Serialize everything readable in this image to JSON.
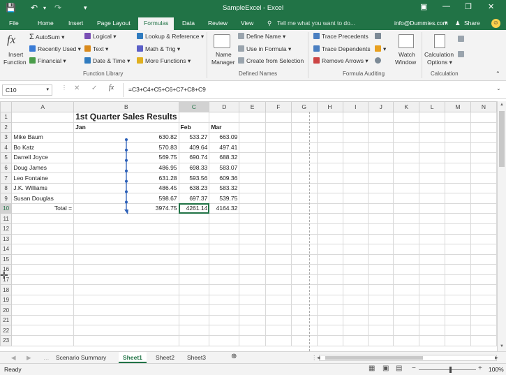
{
  "window": {
    "title": "SampleExcel - Excel",
    "account": "info@Dummies.com",
    "share": "Share",
    "tell_me": "Tell me what you want to do..."
  },
  "tabs": [
    "File",
    "Home",
    "Insert",
    "Page Layout",
    "Formulas",
    "Data",
    "Review",
    "View"
  ],
  "ribbon": {
    "insert_function": [
      "Insert",
      "Function"
    ],
    "library": {
      "autosum": "AutoSum",
      "recent": "Recently Used",
      "financial": "Financial",
      "logical": "Logical",
      "text": "Text",
      "datetime": "Date & Time",
      "lookup": "Lookup & Reference",
      "math": "Math & Trig",
      "more": "More Functions",
      "group": "Function Library"
    },
    "names": {
      "name_manager": [
        "Name",
        "Manager"
      ],
      "define": "Define Name",
      "use": "Use in Formula",
      "create": "Create from Selection",
      "group": "Defined Names"
    },
    "audit": {
      "precedents": "Trace Precedents",
      "dependents": "Trace Dependents",
      "remove": "Remove Arrows",
      "watch": [
        "Watch",
        "Window"
      ],
      "group": "Formula Auditing"
    },
    "calc": {
      "options": [
        "Calculation",
        "Options"
      ],
      "group": "Calculation"
    }
  },
  "formula_bar": {
    "name_box": "C10",
    "formula": "=C3+C4+C5+C6+C7+C8+C9"
  },
  "columns": [
    "A",
    "B",
    "C",
    "D",
    "E",
    "F",
    "G",
    "H",
    "I",
    "J",
    "K",
    "L",
    "M",
    "N"
  ],
  "sheet": {
    "title": "1st Quarter Sales Results",
    "months": [
      "Jan",
      "Feb",
      "Mar"
    ],
    "rows": [
      {
        "name": "Mike Baum",
        "jan": "630.82",
        "feb": "533.27",
        "mar": "663.09"
      },
      {
        "name": "Bo Katz",
        "jan": "570.83",
        "feb": "409.64",
        "mar": "497.41"
      },
      {
        "name": "Darrell Joyce",
        "jan": "569.75",
        "feb": "690.74",
        "mar": "688.32"
      },
      {
        "name": "Doug James",
        "jan": "486.95",
        "feb": "698.33",
        "mar": "583.07"
      },
      {
        "name": "Leo Fontaine",
        "jan": "631.28",
        "feb": "593.56",
        "mar": "609.36"
      },
      {
        "name": "J.K. Williams",
        "jan": "486.45",
        "feb": "638.23",
        "mar": "583.32"
      },
      {
        "name": "Susan Douglas",
        "jan": "598.67",
        "feb": "697.37",
        "mar": "539.75"
      }
    ],
    "total_label": "Total =",
    "totals": {
      "jan": "3974.75",
      "feb": "4261.14",
      "mar": "4164.32"
    }
  },
  "sheet_tabs": [
    "Scenario Summary",
    "Sheet1",
    "Sheet2",
    "Sheet3"
  ],
  "status": {
    "ready": "Ready",
    "zoom": "100%"
  }
}
